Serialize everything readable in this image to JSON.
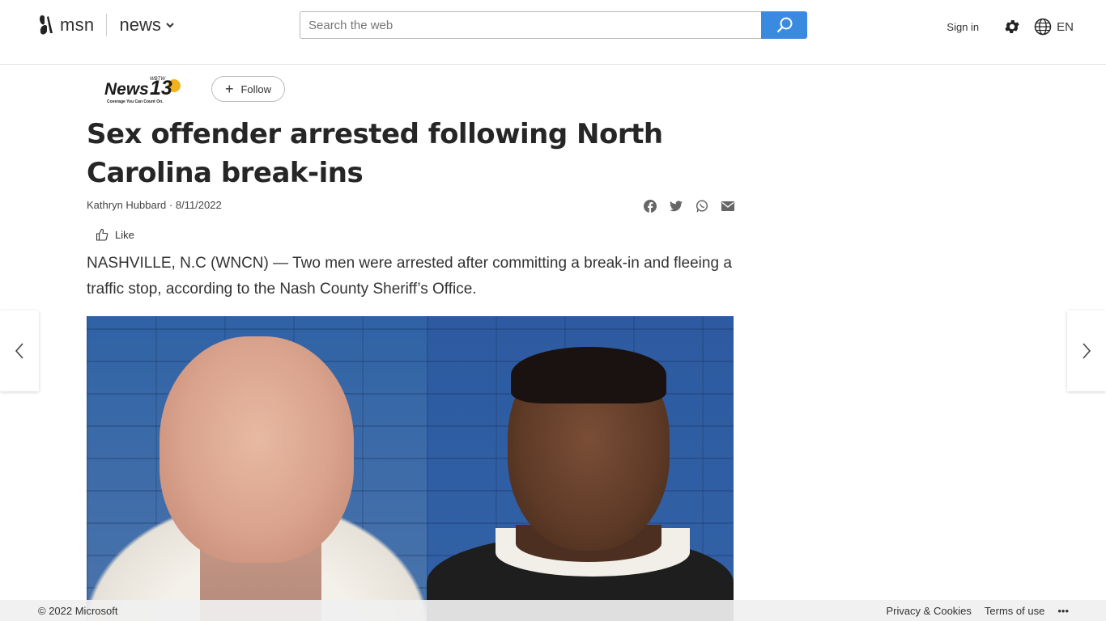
{
  "header": {
    "brand": "msn",
    "section": "news",
    "search_placeholder": "Search the web",
    "sign_in": "Sign in",
    "language": "EN"
  },
  "article": {
    "provider": {
      "logo_main": "News",
      "logo_number": "13",
      "logo_call": "WBTW",
      "logo_tagline": "Coverage You Can Count On."
    },
    "follow_label": "Follow",
    "headline": "Sex offender arrested following North Carolina break-ins",
    "author": "Kathryn Hubbard",
    "date": "8/11/2022",
    "byline_separator": " · ",
    "like_label": "Like",
    "lede": "NASHVILLE, N.C (WNCN) — Two men were arrested after committing a break-in and fleeing a traffic stop, according to the Nash County Sheriff’s Office."
  },
  "footer": {
    "copyright": "© 2022 Microsoft",
    "privacy": "Privacy & Cookies",
    "terms": "Terms of use",
    "more": "•••"
  },
  "colors": {
    "accent": "#3a8be0",
    "text": "#262626"
  }
}
